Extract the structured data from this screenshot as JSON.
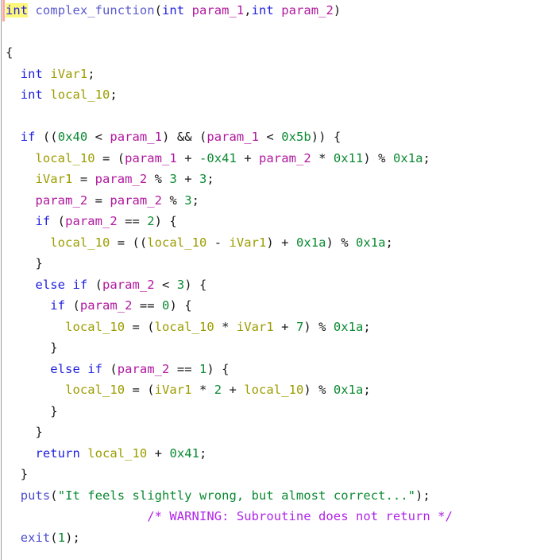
{
  "view": {
    "name": "decompiler-output",
    "background": "#ffffff",
    "gutter_rule_color": "#9b9b9b",
    "selection_marker_color": "#f8a9a0",
    "highlight_color": "#fdf87a"
  },
  "syntax_colors": {
    "keyword": "#2020e0",
    "function": "#4b4bd2",
    "parameter": "#b0179e",
    "local_variable": "#9c9c00",
    "number": "#0a8a32",
    "string": "#0a8a32",
    "comment": "#b024e8",
    "plain": "#191919"
  },
  "code": {
    "lines": [
      {
        "indent": 0,
        "marker": true,
        "tokens": [
          {
            "t": "int",
            "c": "keyword",
            "hl": true
          },
          {
            "t": " ",
            "c": "plain"
          },
          {
            "t": "complex_function",
            "c": "funcname"
          },
          {
            "t": "(",
            "c": "plain"
          },
          {
            "t": "int",
            "c": "keyword"
          },
          {
            "t": " ",
            "c": "plain"
          },
          {
            "t": "param_1",
            "c": "param"
          },
          {
            "t": ",",
            "c": "plain"
          },
          {
            "t": "int",
            "c": "keyword"
          },
          {
            "t": " ",
            "c": "plain"
          },
          {
            "t": "param_2",
            "c": "param"
          },
          {
            "t": ")",
            "c": "plain"
          }
        ]
      },
      {
        "indent": 0,
        "marker": false,
        "tokens": []
      },
      {
        "indent": 0,
        "marker": false,
        "tokens": [
          {
            "t": "{",
            "c": "plain"
          }
        ]
      },
      {
        "indent": 2,
        "marker": false,
        "tokens": [
          {
            "t": "int",
            "c": "keyword"
          },
          {
            "t": " ",
            "c": "plain"
          },
          {
            "t": "iVar1",
            "c": "local"
          },
          {
            "t": ";",
            "c": "plain"
          }
        ]
      },
      {
        "indent": 2,
        "marker": false,
        "tokens": [
          {
            "t": "int",
            "c": "keyword"
          },
          {
            "t": " ",
            "c": "plain"
          },
          {
            "t": "local_10",
            "c": "local"
          },
          {
            "t": ";",
            "c": "plain"
          }
        ]
      },
      {
        "indent": 0,
        "marker": false,
        "tokens": []
      },
      {
        "indent": 2,
        "marker": false,
        "tokens": [
          {
            "t": "if",
            "c": "keyword"
          },
          {
            "t": " ((",
            "c": "plain"
          },
          {
            "t": "0x40",
            "c": "number"
          },
          {
            "t": " < ",
            "c": "plain"
          },
          {
            "t": "param_1",
            "c": "param"
          },
          {
            "t": ") && (",
            "c": "plain"
          },
          {
            "t": "param_1",
            "c": "param"
          },
          {
            "t": " < ",
            "c": "plain"
          },
          {
            "t": "0x5b",
            "c": "number"
          },
          {
            "t": ")) {",
            "c": "plain"
          }
        ]
      },
      {
        "indent": 4,
        "marker": false,
        "tokens": [
          {
            "t": "local_10",
            "c": "local"
          },
          {
            "t": " = (",
            "c": "plain"
          },
          {
            "t": "param_1",
            "c": "param"
          },
          {
            "t": " + ",
            "c": "plain"
          },
          {
            "t": "-0x41",
            "c": "number"
          },
          {
            "t": " + ",
            "c": "plain"
          },
          {
            "t": "param_2",
            "c": "param"
          },
          {
            "t": " * ",
            "c": "plain"
          },
          {
            "t": "0x11",
            "c": "number"
          },
          {
            "t": ") % ",
            "c": "plain"
          },
          {
            "t": "0x1a",
            "c": "number"
          },
          {
            "t": ";",
            "c": "plain"
          }
        ]
      },
      {
        "indent": 4,
        "marker": false,
        "tokens": [
          {
            "t": "iVar1",
            "c": "local"
          },
          {
            "t": " = ",
            "c": "plain"
          },
          {
            "t": "param_2",
            "c": "param"
          },
          {
            "t": " % ",
            "c": "plain"
          },
          {
            "t": "3",
            "c": "number"
          },
          {
            "t": " + ",
            "c": "plain"
          },
          {
            "t": "3",
            "c": "number"
          },
          {
            "t": ";",
            "c": "plain"
          }
        ]
      },
      {
        "indent": 4,
        "marker": false,
        "tokens": [
          {
            "t": "param_2",
            "c": "param"
          },
          {
            "t": " = ",
            "c": "plain"
          },
          {
            "t": "param_2",
            "c": "param"
          },
          {
            "t": " % ",
            "c": "plain"
          },
          {
            "t": "3",
            "c": "number"
          },
          {
            "t": ";",
            "c": "plain"
          }
        ]
      },
      {
        "indent": 4,
        "marker": false,
        "tokens": [
          {
            "t": "if",
            "c": "keyword"
          },
          {
            "t": " (",
            "c": "plain"
          },
          {
            "t": "param_2",
            "c": "param"
          },
          {
            "t": " == ",
            "c": "plain"
          },
          {
            "t": "2",
            "c": "number"
          },
          {
            "t": ") {",
            "c": "plain"
          }
        ]
      },
      {
        "indent": 6,
        "marker": false,
        "tokens": [
          {
            "t": "local_10",
            "c": "local"
          },
          {
            "t": " = ((",
            "c": "plain"
          },
          {
            "t": "local_10",
            "c": "local"
          },
          {
            "t": " - ",
            "c": "plain"
          },
          {
            "t": "iVar1",
            "c": "local"
          },
          {
            "t": ") + ",
            "c": "plain"
          },
          {
            "t": "0x1a",
            "c": "number"
          },
          {
            "t": ") % ",
            "c": "plain"
          },
          {
            "t": "0x1a",
            "c": "number"
          },
          {
            "t": ";",
            "c": "plain"
          }
        ]
      },
      {
        "indent": 4,
        "marker": false,
        "tokens": [
          {
            "t": "}",
            "c": "plain"
          }
        ]
      },
      {
        "indent": 4,
        "marker": false,
        "tokens": [
          {
            "t": "else",
            "c": "keyword"
          },
          {
            "t": " ",
            "c": "plain"
          },
          {
            "t": "if",
            "c": "keyword"
          },
          {
            "t": " (",
            "c": "plain"
          },
          {
            "t": "param_2",
            "c": "param"
          },
          {
            "t": " < ",
            "c": "plain"
          },
          {
            "t": "3",
            "c": "number"
          },
          {
            "t": ") {",
            "c": "plain"
          }
        ]
      },
      {
        "indent": 6,
        "marker": false,
        "tokens": [
          {
            "t": "if",
            "c": "keyword"
          },
          {
            "t": " (",
            "c": "plain"
          },
          {
            "t": "param_2",
            "c": "param"
          },
          {
            "t": " == ",
            "c": "plain"
          },
          {
            "t": "0",
            "c": "number"
          },
          {
            "t": ") {",
            "c": "plain"
          }
        ]
      },
      {
        "indent": 8,
        "marker": false,
        "tokens": [
          {
            "t": "local_10",
            "c": "local"
          },
          {
            "t": " = (",
            "c": "plain"
          },
          {
            "t": "local_10",
            "c": "local"
          },
          {
            "t": " * ",
            "c": "plain"
          },
          {
            "t": "iVar1",
            "c": "local"
          },
          {
            "t": " + ",
            "c": "plain"
          },
          {
            "t": "7",
            "c": "number"
          },
          {
            "t": ") % ",
            "c": "plain"
          },
          {
            "t": "0x1a",
            "c": "number"
          },
          {
            "t": ";",
            "c": "plain"
          }
        ]
      },
      {
        "indent": 6,
        "marker": false,
        "tokens": [
          {
            "t": "}",
            "c": "plain"
          }
        ]
      },
      {
        "indent": 6,
        "marker": false,
        "tokens": [
          {
            "t": "else",
            "c": "keyword"
          },
          {
            "t": " ",
            "c": "plain"
          },
          {
            "t": "if",
            "c": "keyword"
          },
          {
            "t": " (",
            "c": "plain"
          },
          {
            "t": "param_2",
            "c": "param"
          },
          {
            "t": " == ",
            "c": "plain"
          },
          {
            "t": "1",
            "c": "number"
          },
          {
            "t": ") {",
            "c": "plain"
          }
        ]
      },
      {
        "indent": 8,
        "marker": false,
        "tokens": [
          {
            "t": "local_10",
            "c": "local"
          },
          {
            "t": " = (",
            "c": "plain"
          },
          {
            "t": "iVar1",
            "c": "local"
          },
          {
            "t": " * ",
            "c": "plain"
          },
          {
            "t": "2",
            "c": "number"
          },
          {
            "t": " + ",
            "c": "plain"
          },
          {
            "t": "local_10",
            "c": "local"
          },
          {
            "t": ") % ",
            "c": "plain"
          },
          {
            "t": "0x1a",
            "c": "number"
          },
          {
            "t": ";",
            "c": "plain"
          }
        ]
      },
      {
        "indent": 6,
        "marker": false,
        "tokens": [
          {
            "t": "}",
            "c": "plain"
          }
        ]
      },
      {
        "indent": 4,
        "marker": false,
        "tokens": [
          {
            "t": "}",
            "c": "plain"
          }
        ]
      },
      {
        "indent": 4,
        "marker": false,
        "tokens": [
          {
            "t": "return",
            "c": "keyword"
          },
          {
            "t": " ",
            "c": "plain"
          },
          {
            "t": "local_10",
            "c": "local"
          },
          {
            "t": " + ",
            "c": "plain"
          },
          {
            "t": "0x41",
            "c": "number"
          },
          {
            "t": ";",
            "c": "plain"
          }
        ]
      },
      {
        "indent": 2,
        "marker": false,
        "tokens": [
          {
            "t": "}",
            "c": "plain"
          }
        ]
      },
      {
        "indent": 2,
        "marker": false,
        "tokens": [
          {
            "t": "puts",
            "c": "func"
          },
          {
            "t": "(",
            "c": "plain"
          },
          {
            "t": "\"It feels slightly wrong, but almost correct...\"",
            "c": "string"
          },
          {
            "t": ");",
            "c": "plain"
          }
        ]
      },
      {
        "indent": 19,
        "marker": false,
        "tokens": [
          {
            "t": "/* WARNING: Subroutine does not return */",
            "c": "comment"
          }
        ]
      },
      {
        "indent": 2,
        "marker": false,
        "tokens": [
          {
            "t": "exit",
            "c": "func"
          },
          {
            "t": "(",
            "c": "plain"
          },
          {
            "t": "1",
            "c": "number"
          },
          {
            "t": ");",
            "c": "plain"
          }
        ]
      }
    ]
  }
}
